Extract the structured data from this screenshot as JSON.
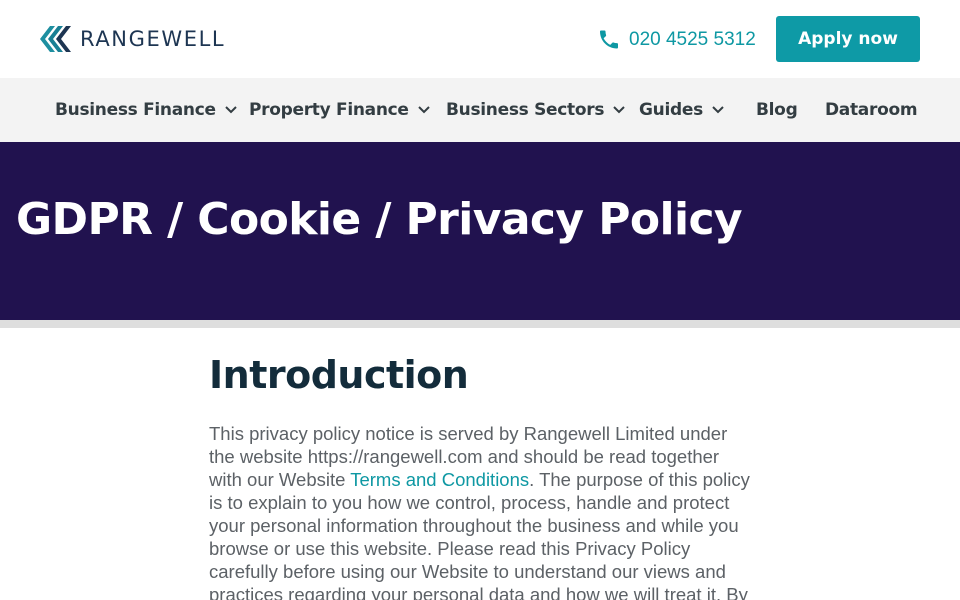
{
  "header": {
    "brand": "RANGEWELL",
    "phone": "020 4525 5312",
    "apply_label": "Apply now"
  },
  "nav": {
    "items": [
      {
        "label": "Business Finance",
        "has_dropdown": true
      },
      {
        "label": "Property Finance",
        "has_dropdown": true
      },
      {
        "label": "Business Sectors",
        "has_dropdown": true
      },
      {
        "label": "Guides",
        "has_dropdown": true
      },
      {
        "label": "Blog",
        "has_dropdown": false
      },
      {
        "label": "Dataroom",
        "has_dropdown": false
      }
    ]
  },
  "hero": {
    "title": "GDPR / Cookie / Privacy Policy"
  },
  "content": {
    "heading": "Introduction",
    "para_before_link": "This privacy policy notice is served by Rangewell Limited under the website https://rangewell.com and should be read together with our Website ",
    "link_text": "Terms and Conditions",
    "para_after_link": ". The purpose of this policy is to explain to you how we control, process, handle and protect your personal information throughout the business and while you browse or use this website. Please read this Privacy Policy carefully before using our Website to understand our views and practices regarding your personal data and how we will treat it. By using our Website,"
  },
  "colors": {
    "accent": "#0e9aa6",
    "hero_bg": "#21124f",
    "nav_bg": "#f3f3f3",
    "brand_text": "#1d3552"
  },
  "icons": {
    "logo": "rangewell-logo-icon",
    "phone": "phone-icon",
    "dropdown": "chevron-down-icon"
  }
}
